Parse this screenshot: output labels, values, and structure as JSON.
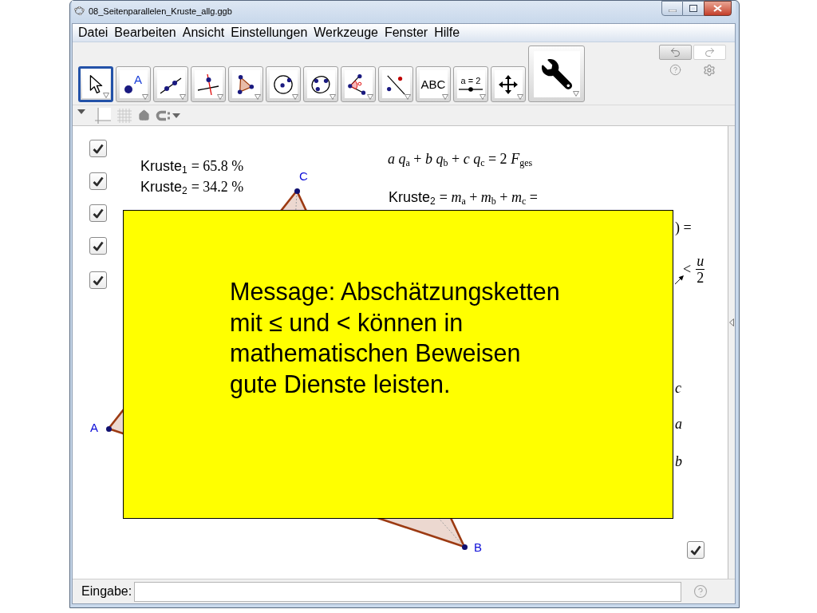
{
  "window": {
    "title": "08_Seitenparallelen_Kruste_allg.ggb"
  },
  "menu": [
    "Datei",
    "Bearbeiten",
    "Ansicht",
    "Einstellungen",
    "Werkzeuge",
    "Fenster",
    "Hilfe"
  ],
  "toolbar": {
    "tools": [
      {
        "kind": "move",
        "selected": true
      },
      {
        "kind": "point",
        "label": "A",
        "selected": false
      },
      {
        "kind": "line",
        "selected": false
      },
      {
        "kind": "perpendicular",
        "selected": false
      },
      {
        "kind": "polygon",
        "selected": false
      },
      {
        "kind": "circle_center",
        "selected": false
      },
      {
        "kind": "circle_three",
        "selected": false
      },
      {
        "kind": "angle",
        "selected": false
      },
      {
        "kind": "reflect",
        "selected": false
      },
      {
        "kind": "text",
        "label": "ABC",
        "selected": false
      },
      {
        "kind": "slider",
        "label": "a = 2",
        "selected": false
      },
      {
        "kind": "move_view",
        "selected": false
      },
      {
        "kind": "custom",
        "selected": false
      }
    ],
    "undo": {
      "disabled": false
    },
    "redo": {
      "disabled": true
    }
  },
  "graphics": {
    "checkboxes": [
      {
        "checked": true
      },
      {
        "checked": true
      },
      {
        "checked": true
      },
      {
        "checked": true
      },
      {
        "checked": true
      },
      {
        "checked": true
      }
    ],
    "results": [
      {
        "label": "Kruste$_{1}$",
        "value": "= 65.8 %"
      },
      {
        "label": "Kruste$_{2}$",
        "value": "= 34.2 %"
      }
    ],
    "formulas": [
      {
        "kind": "math",
        "text": "*a q*$_{a}$ + *b q*$_{b}$ + *c q*$_{c}$ = 2 *F*$_{ges}$"
      },
      {
        "kind": "labeled",
        "label": "Kruste$_{2}$",
        "text": "= *m*$_{a}$ + *m*$_{b}$ + *m*$_{c}$ ="
      },
      {
        "kind": "math",
        "text": ") ="
      },
      {
        "kind": "fraction",
        "relation": "<",
        "numerator": "u",
        "denominator": "2"
      },
      {
        "kind": "variable",
        "text": "c"
      },
      {
        "kind": "variable",
        "text": "a"
      },
      {
        "kind": "variable",
        "text": "b"
      }
    ],
    "points": [
      {
        "label": "C"
      },
      {
        "label": "A"
      },
      {
        "label": "B"
      }
    ],
    "message": "Message: Abschätzungsketten mit ≤ und < können in mathematischen Beweisen gute Dienste leisten."
  },
  "input_bar": {
    "label": "Eingabe:"
  }
}
